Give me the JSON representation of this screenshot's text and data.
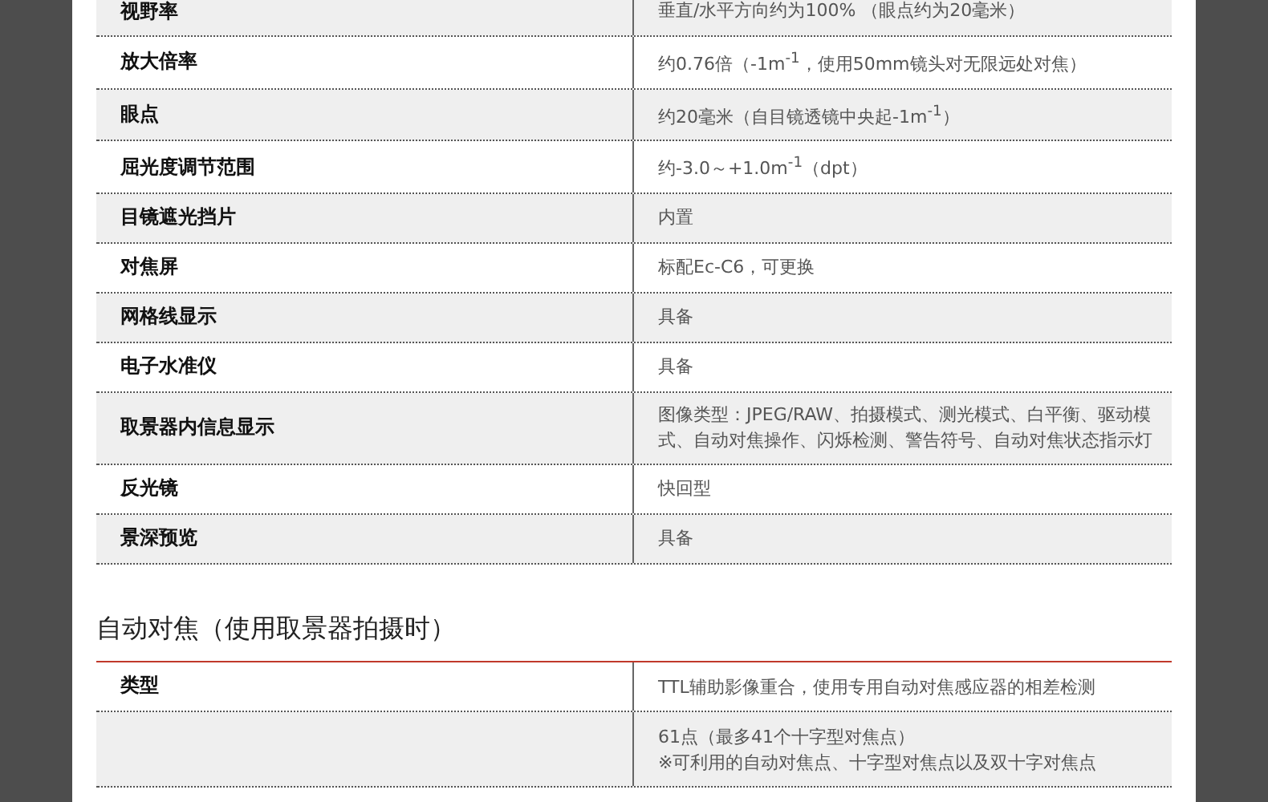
{
  "spec_table": {
    "rows": [
      {
        "label": "视野率",
        "value": "垂直/水平方向约为100% （眼点约为20毫米）"
      },
      {
        "label": "放大倍率",
        "value": "约0.76倍（-1m$^{-1}$，使用50mm镜头对无限远处对焦）"
      },
      {
        "label": "眼点",
        "value": "约20毫米（自目镜透镜中央起-1m$^{-1}$）"
      },
      {
        "label": "屈光度调节范围",
        "value": "约-3.0～+1.0m$^{-1}$（dpt）"
      },
      {
        "label": "目镜遮光挡片",
        "value": "内置"
      },
      {
        "label": "对焦屏",
        "value": "标配Ec-C6，可更换"
      },
      {
        "label": "网格线显示",
        "value": "具备"
      },
      {
        "label": "电子水准仪",
        "value": "具备"
      },
      {
        "label": "取景器内信息显示",
        "value": "图像类型：JPEG/RAW、拍摄模式、测光模式、白平衡、驱动模式、自动对焦操作、闪烁检测、警告符号、自动对焦状态指示灯"
      },
      {
        "label": "反光镜",
        "value": "快回型"
      },
      {
        "label": "景深预览",
        "value": "具备"
      }
    ]
  },
  "af_section": {
    "heading": "自动对焦（使用取景器拍摄时）",
    "rows": [
      {
        "label": "类型",
        "lines": [
          "TTL辅助影像重合，使用专用自动对焦感应器的相差检测"
        ]
      },
      {
        "label": "",
        "lines": [
          "61点（最多41个十字型对焦点）",
          "※可利用的自动对焦点、十字型对焦点以及双十字对焦点"
        ]
      }
    ]
  }
}
